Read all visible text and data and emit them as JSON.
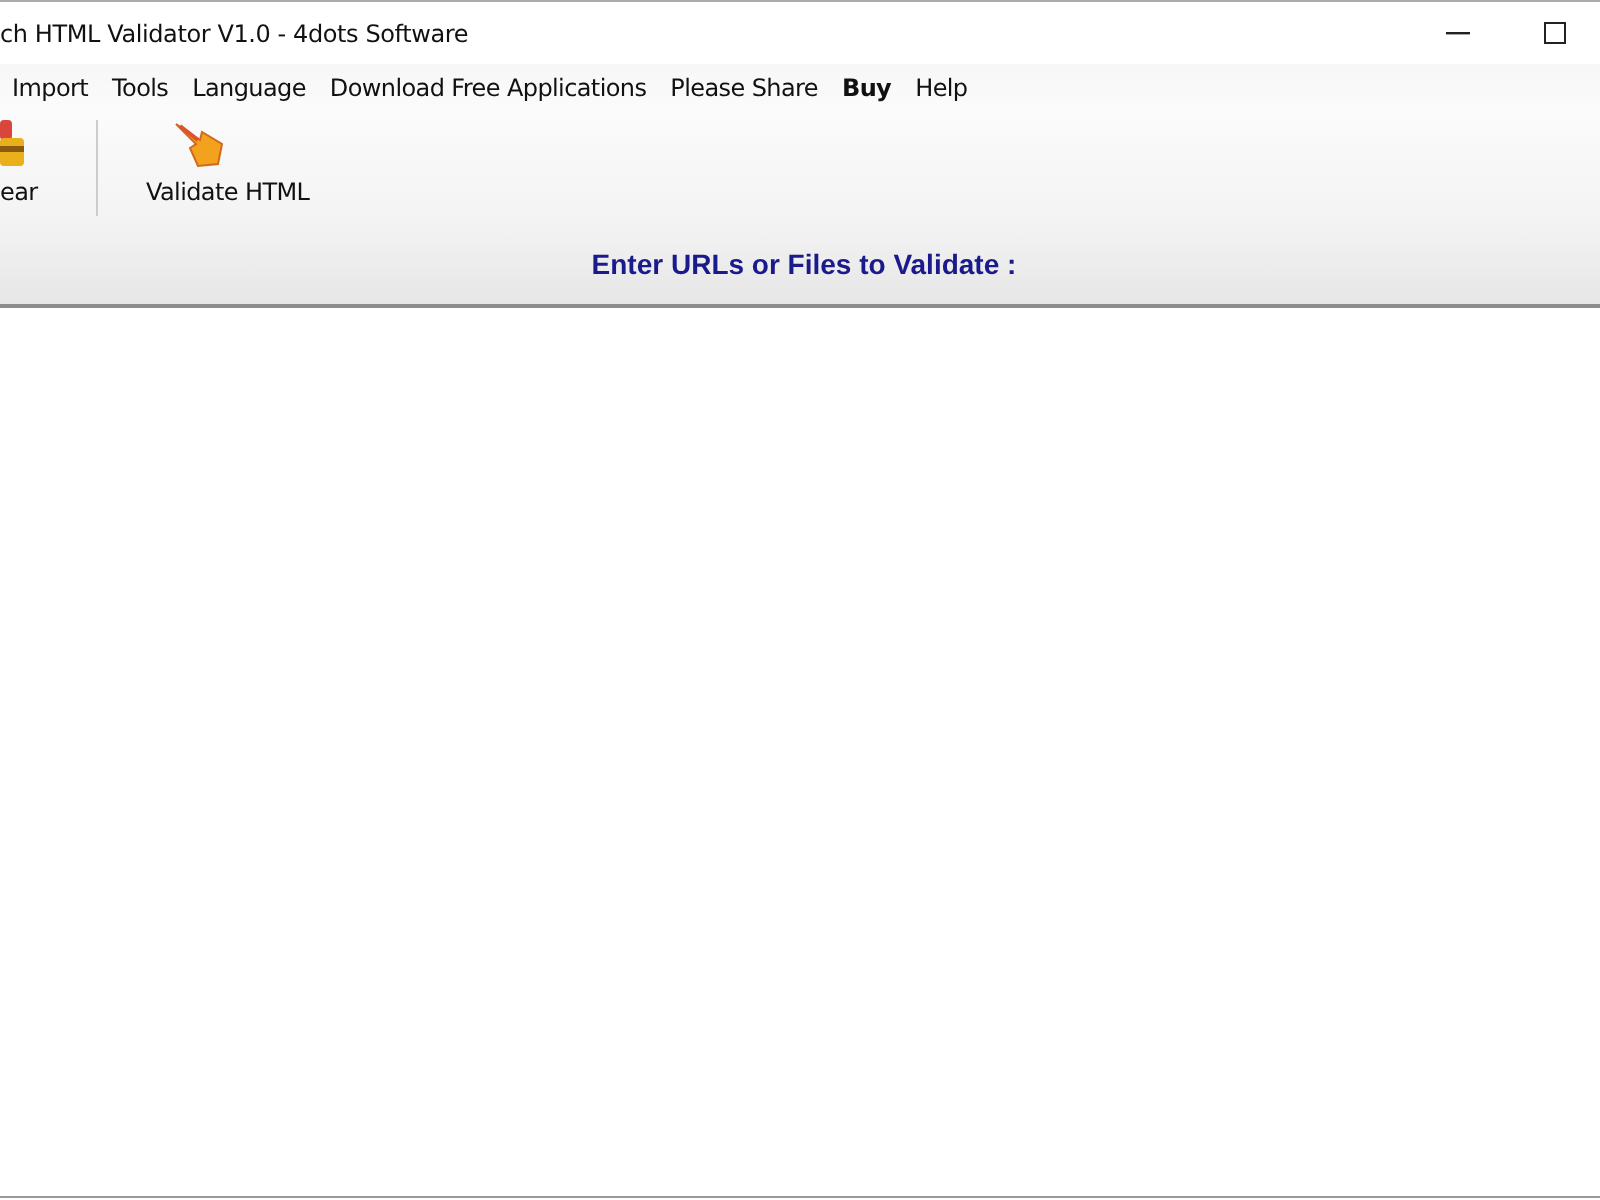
{
  "window": {
    "title": "ch HTML Validator V1.0 - 4dots Software"
  },
  "menu": [
    {
      "label": "Import",
      "emphasized": false
    },
    {
      "label": "Tools",
      "emphasized": false
    },
    {
      "label": "Language",
      "emphasized": false
    },
    {
      "label": "Download Free Applications",
      "emphasized": false
    },
    {
      "label": "Please Share",
      "emphasized": false
    },
    {
      "label": "Buy",
      "emphasized": true
    },
    {
      "label": "Help",
      "emphasized": false
    }
  ],
  "toolbar": [
    {
      "label": "ear",
      "kind": "clear"
    },
    {
      "label": "Validate HTML",
      "kind": "validate"
    }
  ],
  "header": {
    "text": "Enter URLs or Files to Validate :"
  }
}
